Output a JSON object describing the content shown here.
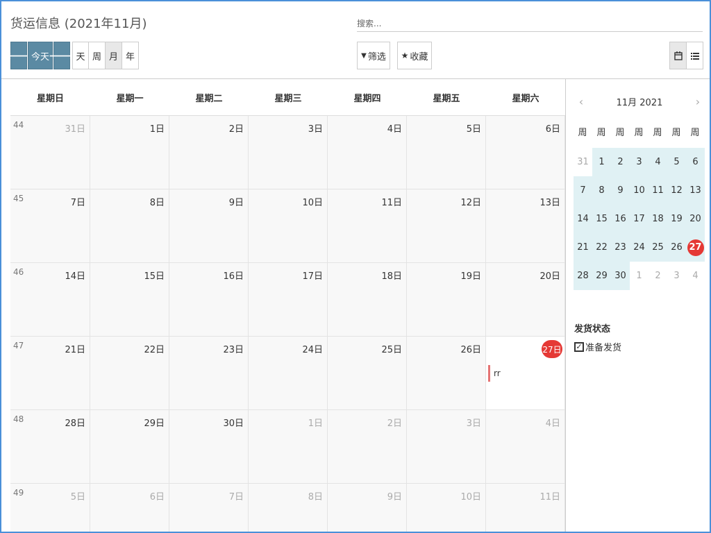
{
  "header": {
    "title": "货运信息 (2021年11月)",
    "search_placeholder": "搜索...",
    "today_label": "今天",
    "prev_icon": "arrow-left-icon",
    "next_icon": "arrow-right-icon",
    "view_day": "天",
    "view_week": "周",
    "view_month": "月",
    "view_year": "年",
    "active_view": "月",
    "filter_label": "筛选",
    "favorites_label": "收藏",
    "calendar_view_icon": "calendar-icon",
    "list_view_icon": "list-icon"
  },
  "calendar": {
    "weekdays": [
      "星期日",
      "星期一",
      "星期二",
      "星期三",
      "星期四",
      "星期五",
      "星期六"
    ],
    "weeks": [
      {
        "num": "44",
        "days": [
          {
            "d": "31日",
            "other": true
          },
          {
            "d": "1日"
          },
          {
            "d": "2日"
          },
          {
            "d": "3日"
          },
          {
            "d": "4日"
          },
          {
            "d": "5日"
          },
          {
            "d": "6日"
          }
        ]
      },
      {
        "num": "45",
        "days": [
          {
            "d": "7日"
          },
          {
            "d": "8日"
          },
          {
            "d": "9日"
          },
          {
            "d": "10日"
          },
          {
            "d": "11日"
          },
          {
            "d": "12日"
          },
          {
            "d": "13日"
          }
        ]
      },
      {
        "num": "46",
        "days": [
          {
            "d": "14日"
          },
          {
            "d": "15日"
          },
          {
            "d": "16日"
          },
          {
            "d": "17日"
          },
          {
            "d": "18日"
          },
          {
            "d": "19日"
          },
          {
            "d": "20日"
          }
        ]
      },
      {
        "num": "47",
        "days": [
          {
            "d": "21日"
          },
          {
            "d": "22日"
          },
          {
            "d": "23日"
          },
          {
            "d": "24日"
          },
          {
            "d": "25日"
          },
          {
            "d": "26日"
          },
          {
            "d": "27日",
            "today": true,
            "event": "rr"
          }
        ]
      },
      {
        "num": "48",
        "days": [
          {
            "d": "28日"
          },
          {
            "d": "29日"
          },
          {
            "d": "30日"
          },
          {
            "d": "1日",
            "other": true
          },
          {
            "d": "2日",
            "other": true
          },
          {
            "d": "3日",
            "other": true
          },
          {
            "d": "4日",
            "other": true
          }
        ]
      },
      {
        "num": "49",
        "days": [
          {
            "d": "5日",
            "other": true
          },
          {
            "d": "6日",
            "other": true
          },
          {
            "d": "7日",
            "other": true
          },
          {
            "d": "8日",
            "other": true
          },
          {
            "d": "9日",
            "other": true
          },
          {
            "d": "10日",
            "other": true
          },
          {
            "d": "11日",
            "other": true
          }
        ]
      }
    ],
    "today_color": "#e53935",
    "event_color": "#e57373"
  },
  "mini_calendar": {
    "title": "11月 2021",
    "prev": "‹",
    "next": "›",
    "dow": [
      "周",
      "周",
      "周",
      "周",
      "周",
      "周",
      "周"
    ],
    "weeks": [
      [
        {
          "d": "31",
          "other": true
        },
        {
          "d": "1",
          "in": true
        },
        {
          "d": "2",
          "in": true
        },
        {
          "d": "3",
          "in": true
        },
        {
          "d": "4",
          "in": true
        },
        {
          "d": "5",
          "in": true
        },
        {
          "d": "6",
          "in": true
        }
      ],
      [
        {
          "d": "7",
          "in": true
        },
        {
          "d": "8",
          "in": true
        },
        {
          "d": "9",
          "in": true
        },
        {
          "d": "10",
          "in": true
        },
        {
          "d": "11",
          "in": true
        },
        {
          "d": "12",
          "in": true
        },
        {
          "d": "13",
          "in": true
        }
      ],
      [
        {
          "d": "14",
          "in": true
        },
        {
          "d": "15",
          "in": true
        },
        {
          "d": "16",
          "in": true
        },
        {
          "d": "17",
          "in": true
        },
        {
          "d": "18",
          "in": true
        },
        {
          "d": "19",
          "in": true
        },
        {
          "d": "20",
          "in": true
        }
      ],
      [
        {
          "d": "21",
          "in": true
        },
        {
          "d": "22",
          "in": true
        },
        {
          "d": "23",
          "in": true
        },
        {
          "d": "24",
          "in": true
        },
        {
          "d": "25",
          "in": true
        },
        {
          "d": "26",
          "in": true
        },
        {
          "d": "27",
          "in": true,
          "today": true
        }
      ],
      [
        {
          "d": "28",
          "in": true
        },
        {
          "d": "29",
          "in": true
        },
        {
          "d": "30",
          "in": true
        },
        {
          "d": "1",
          "other": true
        },
        {
          "d": "2",
          "other": true
        },
        {
          "d": "3",
          "other": true
        },
        {
          "d": "4",
          "other": true
        }
      ]
    ]
  },
  "filters": {
    "title": "发货状态",
    "items": [
      {
        "label": "准备发货",
        "checked": true
      }
    ]
  }
}
